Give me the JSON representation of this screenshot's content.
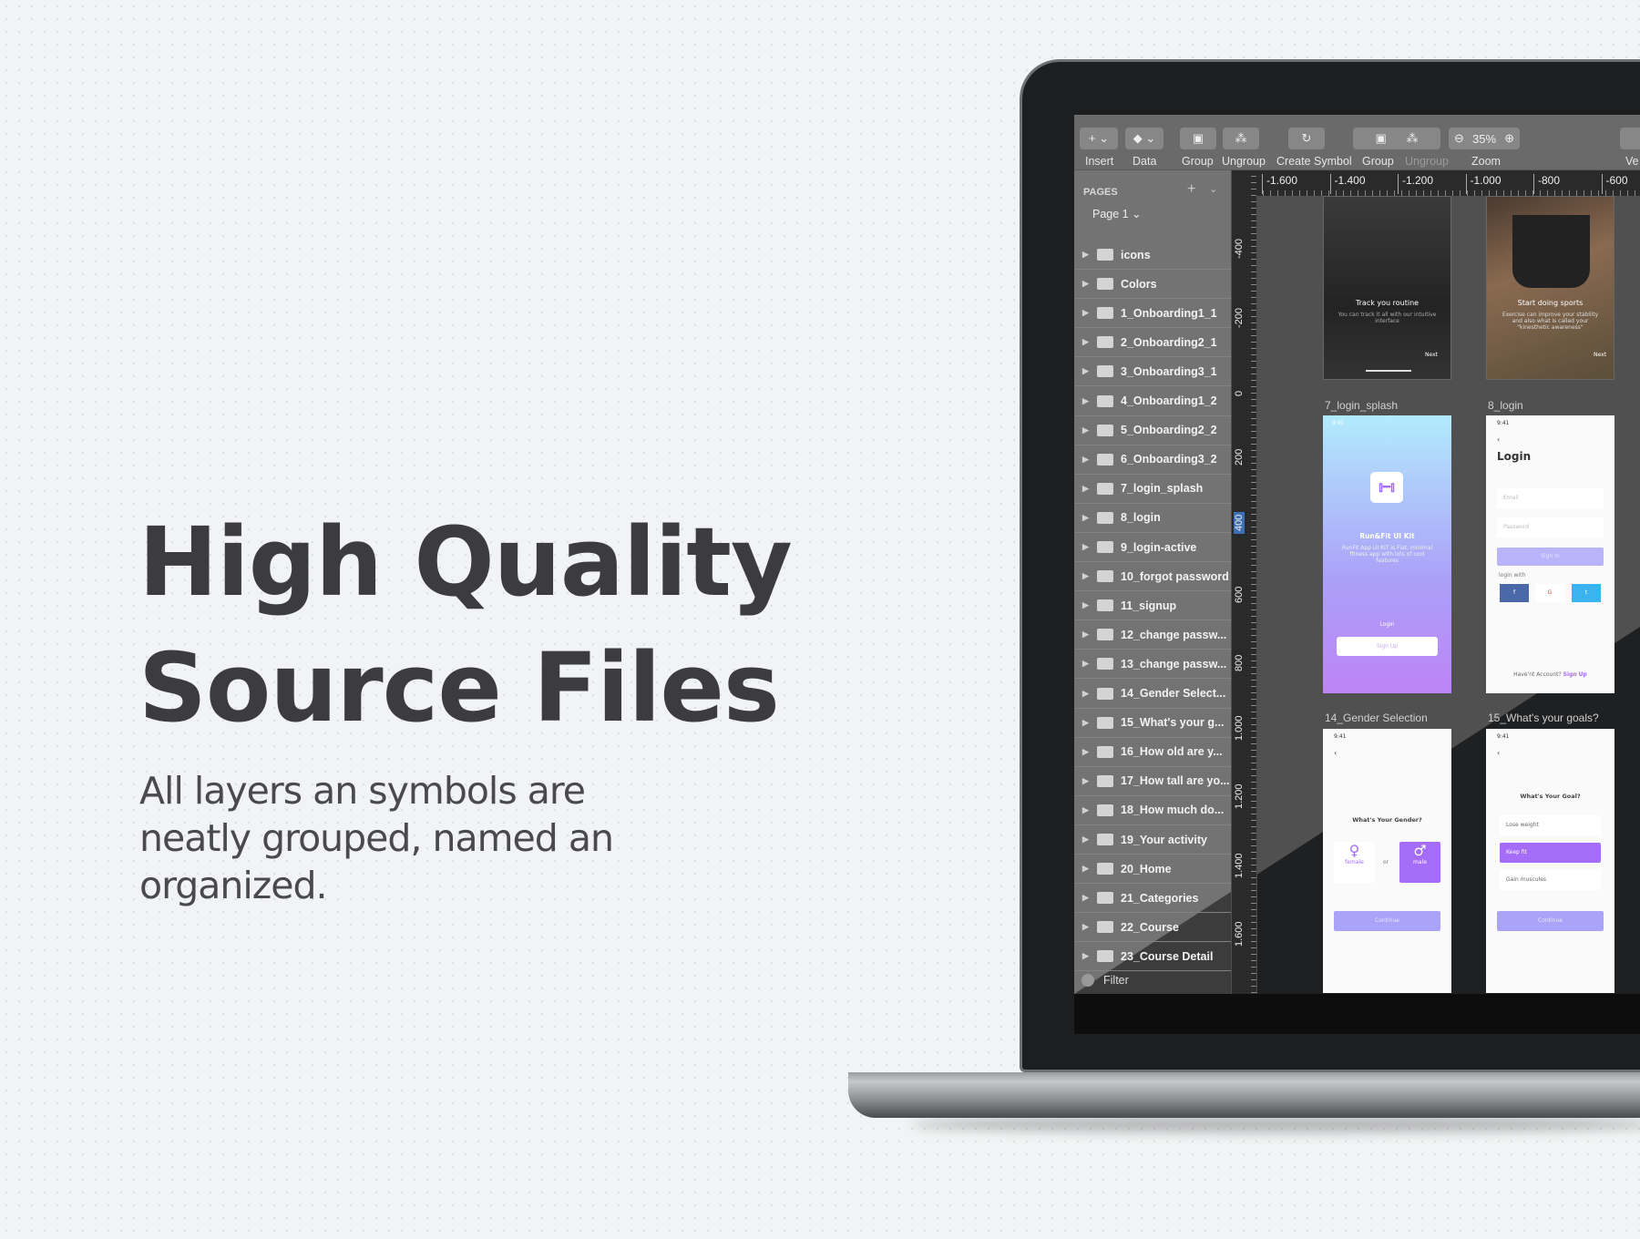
{
  "hero": {
    "headline_line1": "High Quality",
    "headline_line2": "Source Files",
    "subtitle": "All layers an symbols are neatly grouped, named an organized."
  },
  "toolbar": {
    "insert": "Insert",
    "data": "Data",
    "group": "Group",
    "ungroup": "Ungroup",
    "create_symbol": "Create Symbol",
    "group2": "Group",
    "ungroup2": "Ungroup",
    "zoom_label": "Zoom",
    "zoom_value": "35%",
    "view": "Ve"
  },
  "sidebar": {
    "header": "PAGES",
    "current_page": "Page 1",
    "filter": "Filter",
    "items": [
      "icons",
      "Colors",
      "1_Onboarding1_1",
      "2_Onboarding2_1",
      "3_Onboarding3_1",
      "4_Onboarding1_2",
      "5_Onboarding2_2",
      "6_Onboarding3_2",
      "7_login_splash",
      "8_login",
      "9_login-active",
      "10_forgot password",
      "11_signup",
      "12_change passw...",
      "13_change passw...",
      "14_Gender Select...",
      "15_What's your g...",
      "16_How old are y...",
      "17_How tall are yo...",
      "18_How much do...",
      "19_Your activity",
      "20_Home",
      "21_Categories",
      "22_Course",
      "23_Course Detail"
    ]
  },
  "rulers": {
    "horizontal": [
      "-1.600",
      "-1.400",
      "-1.200",
      "-1.000",
      "-800",
      "-600"
    ],
    "vertical": [
      "-400",
      "-200",
      "0",
      "200",
      "400",
      "600",
      "800",
      "1.000",
      "1.200",
      "1.400",
      "1.600"
    ],
    "highlighted": "400"
  },
  "artboards": {
    "onboard1": {
      "title": "Track you routine",
      "text": "You can track it all with our intuitive interface",
      "next": "Next"
    },
    "onboard2": {
      "title": "Start doing sports",
      "text": "Exercise can improve your stability and also what is called your \"kinesthetic awareness\"",
      "next": "Next"
    },
    "splash": {
      "label": "7_login_splash",
      "time": "9:41",
      "app": "Run&Fit UI Kit",
      "desc": "RunFit App UI KIT is Flat, minimal fitness app with lots of cool features",
      "login": "Login",
      "signup": "Sign Up"
    },
    "login": {
      "label": "8_login",
      "time": "9:41",
      "title": "Login",
      "email": "Email",
      "password": "Password",
      "signin": "Sign In",
      "login_with": "login with",
      "no_account": "Have'nt Account?",
      "signup": "Sign Up"
    },
    "gender": {
      "label": "14_Gender Selection",
      "time": "9:41",
      "question": "What's Your Gender?",
      "female": "female",
      "or": "or",
      "male": "male",
      "continue": "Continue"
    },
    "goals": {
      "label": "15_What's your goals?",
      "time": "9:41",
      "question": "What's Your Goal?",
      "options": [
        "Lose weight",
        "Keep fit",
        "Gain muscules"
      ],
      "continue": "Continue"
    }
  },
  "colors": {
    "accent": "#a56cf7",
    "button": "#aaa4f8",
    "facebook": "#4a67a8",
    "twitter": "#3ab3f0"
  }
}
